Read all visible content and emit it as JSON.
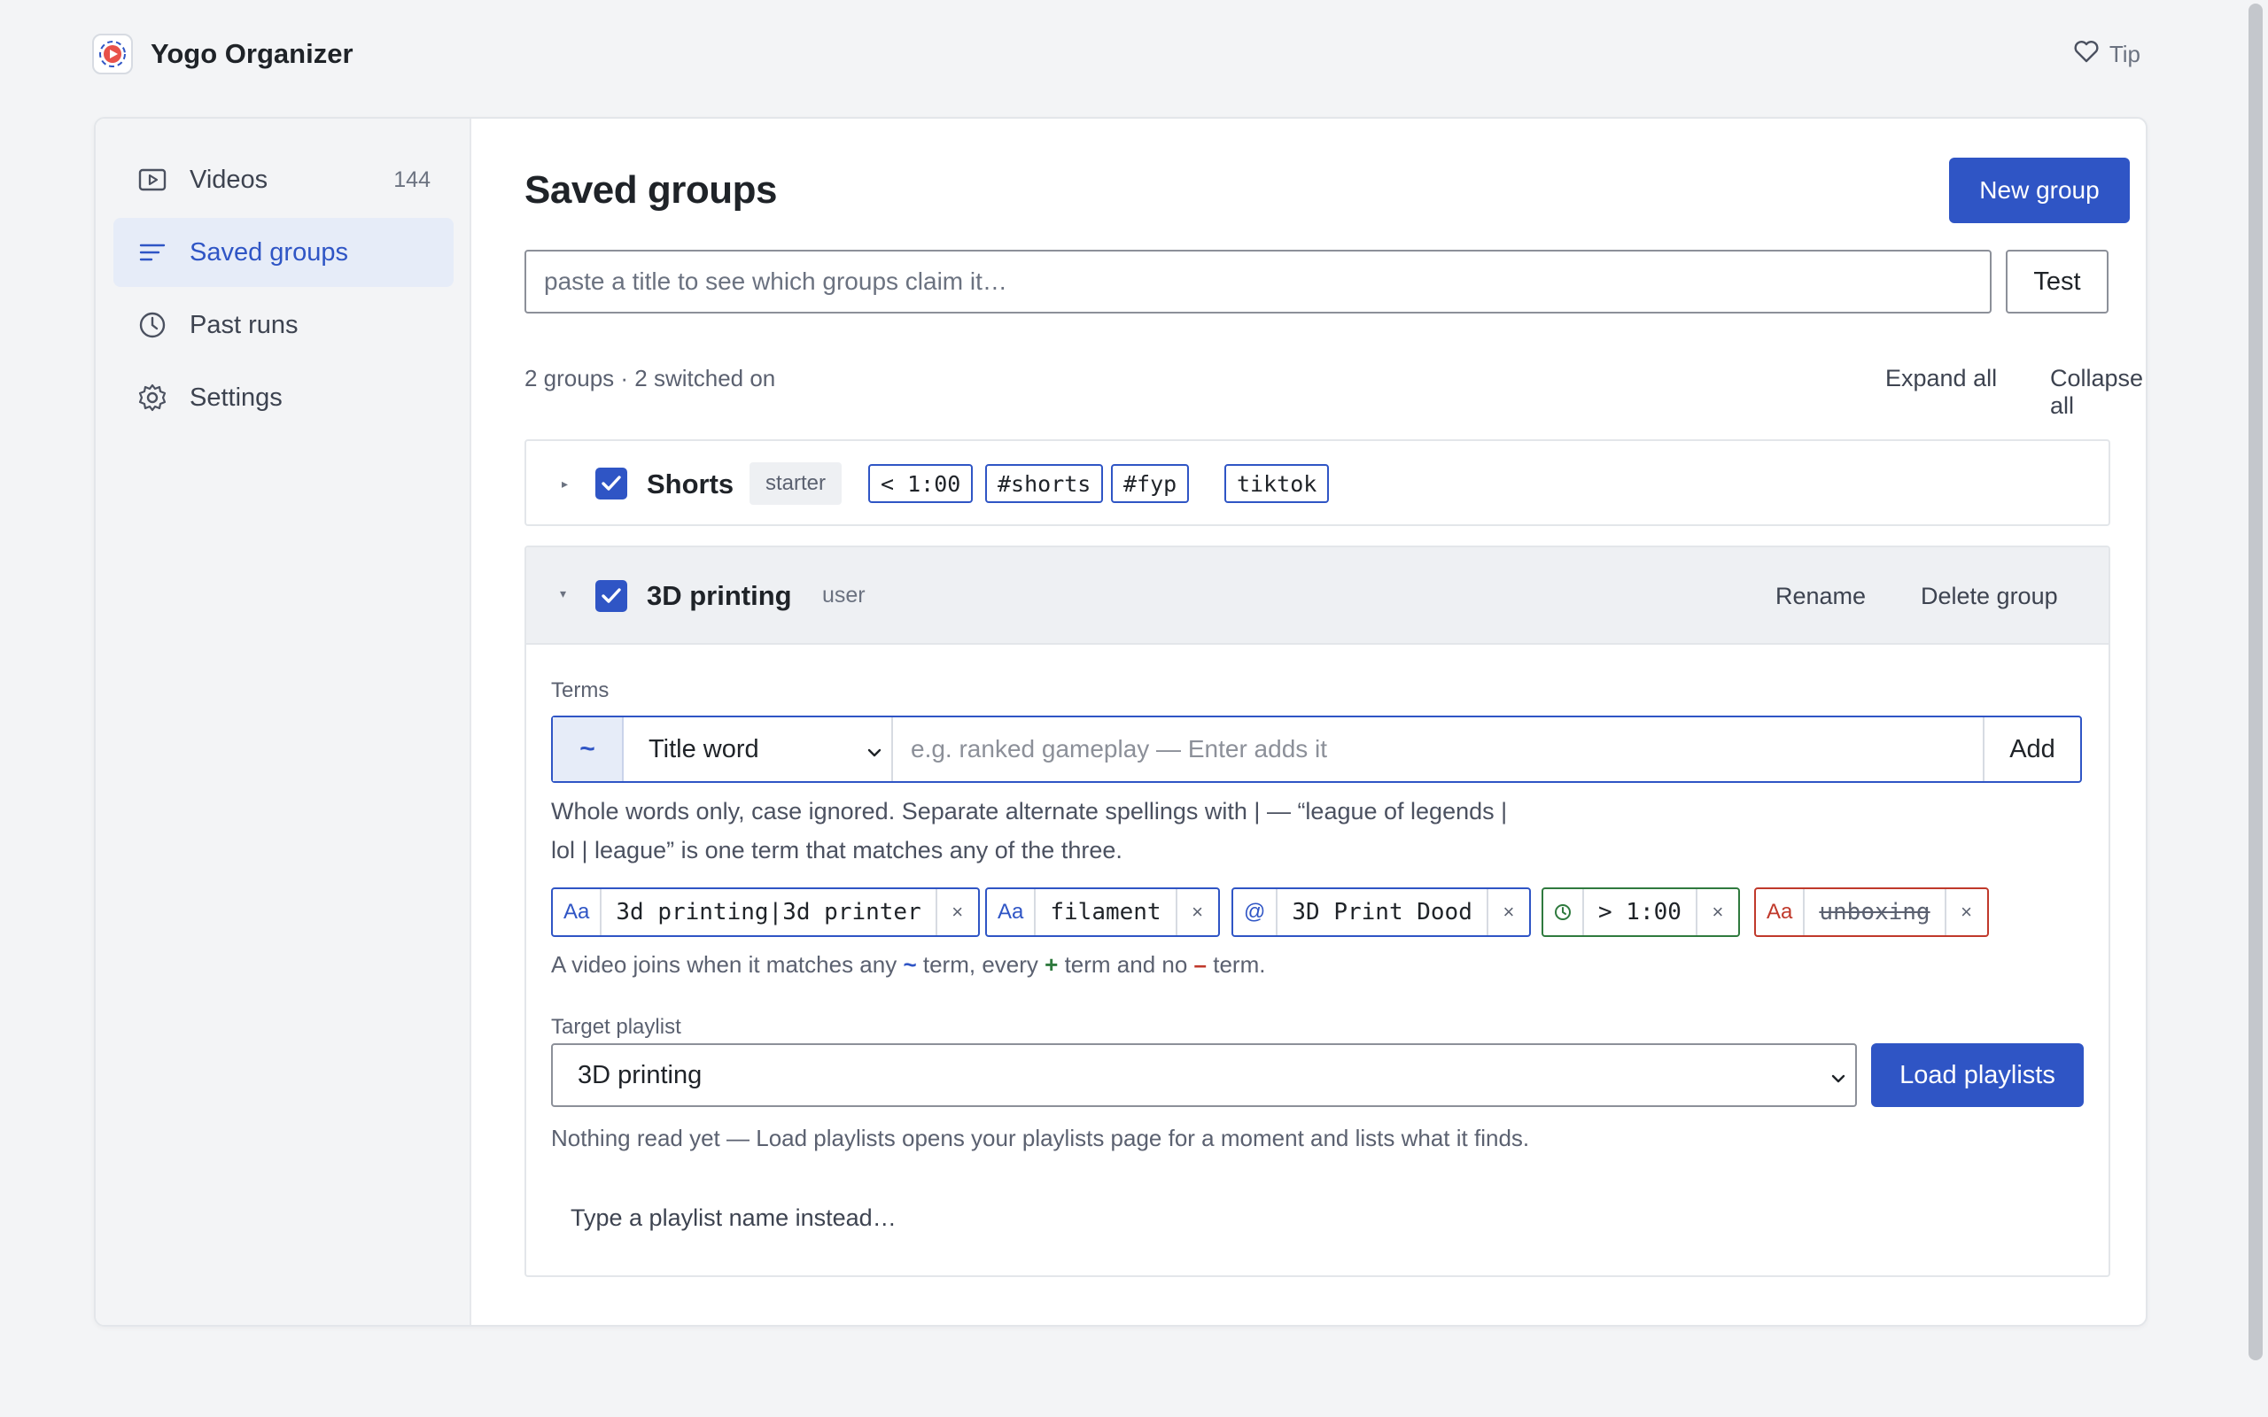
{
  "app": {
    "title": "Yogo Organizer",
    "tip_label": "Tip"
  },
  "sidebar": {
    "items": [
      {
        "label": "Videos",
        "count": "144",
        "icon": "video-icon"
      },
      {
        "label": "Saved groups",
        "icon": "list-icon",
        "active": true
      },
      {
        "label": "Past runs",
        "icon": "clock-icon"
      },
      {
        "label": "Settings",
        "icon": "gear-icon"
      }
    ]
  },
  "main": {
    "title": "Saved groups",
    "new_group_label": "New group",
    "help_label": "?",
    "test_placeholder": "paste a title to see which groups claim it…",
    "test_label": "Test",
    "summary": "2 groups · 2 switched on",
    "expand_all": "Expand all",
    "collapse_all": "Collapse all"
  },
  "groups": [
    {
      "name": "Shorts",
      "tag": "starter",
      "checked": true,
      "chips": [
        "< 1:00",
        "#shorts",
        "#fyp",
        "tiktok"
      ]
    },
    {
      "name": "3D printing",
      "tag": "user",
      "checked": true,
      "rename_label": "Rename",
      "delete_label": "Delete group",
      "terms_label": "Terms",
      "term_mode": "~",
      "term_kind": "Title word",
      "term_placeholder": "e.g. ranked gameplay — Enter adds it",
      "add_label": "Add",
      "help_text": "Whole words only, case ignored. Separate alternate spellings with | — “league of legends | lol | league” is one term that matches any of the three.",
      "terms": [
        {
          "prefix": "Aa",
          "text": "3d printing|3d printer",
          "kind": "any"
        },
        {
          "prefix": "Aa",
          "text": "filament",
          "kind": "any"
        },
        {
          "prefix": "@",
          "text": "3D Print Dood",
          "kind": "any"
        },
        {
          "prefix": "clock-icon",
          "text": "> 1:00",
          "kind": "every"
        },
        {
          "prefix": "Aa",
          "text": "unboxing",
          "kind": "none"
        }
      ],
      "remove_glyph": "×",
      "rule": {
        "part1": "A video joins when it matches any",
        "any_sym": "~",
        "part2": "term, every",
        "every_sym": "+",
        "part3": "term and no",
        "none_sym": "–",
        "part4": "term."
      },
      "target_label": "Target playlist",
      "target_value": "3D printing",
      "load_label": "Load playlists",
      "note": "Nothing read yet — Load playlists opens your playlists page for a moment and lists what it finds.",
      "type_instead": "Type a playlist name instead…"
    }
  ],
  "colors": {
    "accent": "#2f55c5",
    "green": "#2f7a3e",
    "red": "#c0392b",
    "background": "#f3f4f6"
  }
}
